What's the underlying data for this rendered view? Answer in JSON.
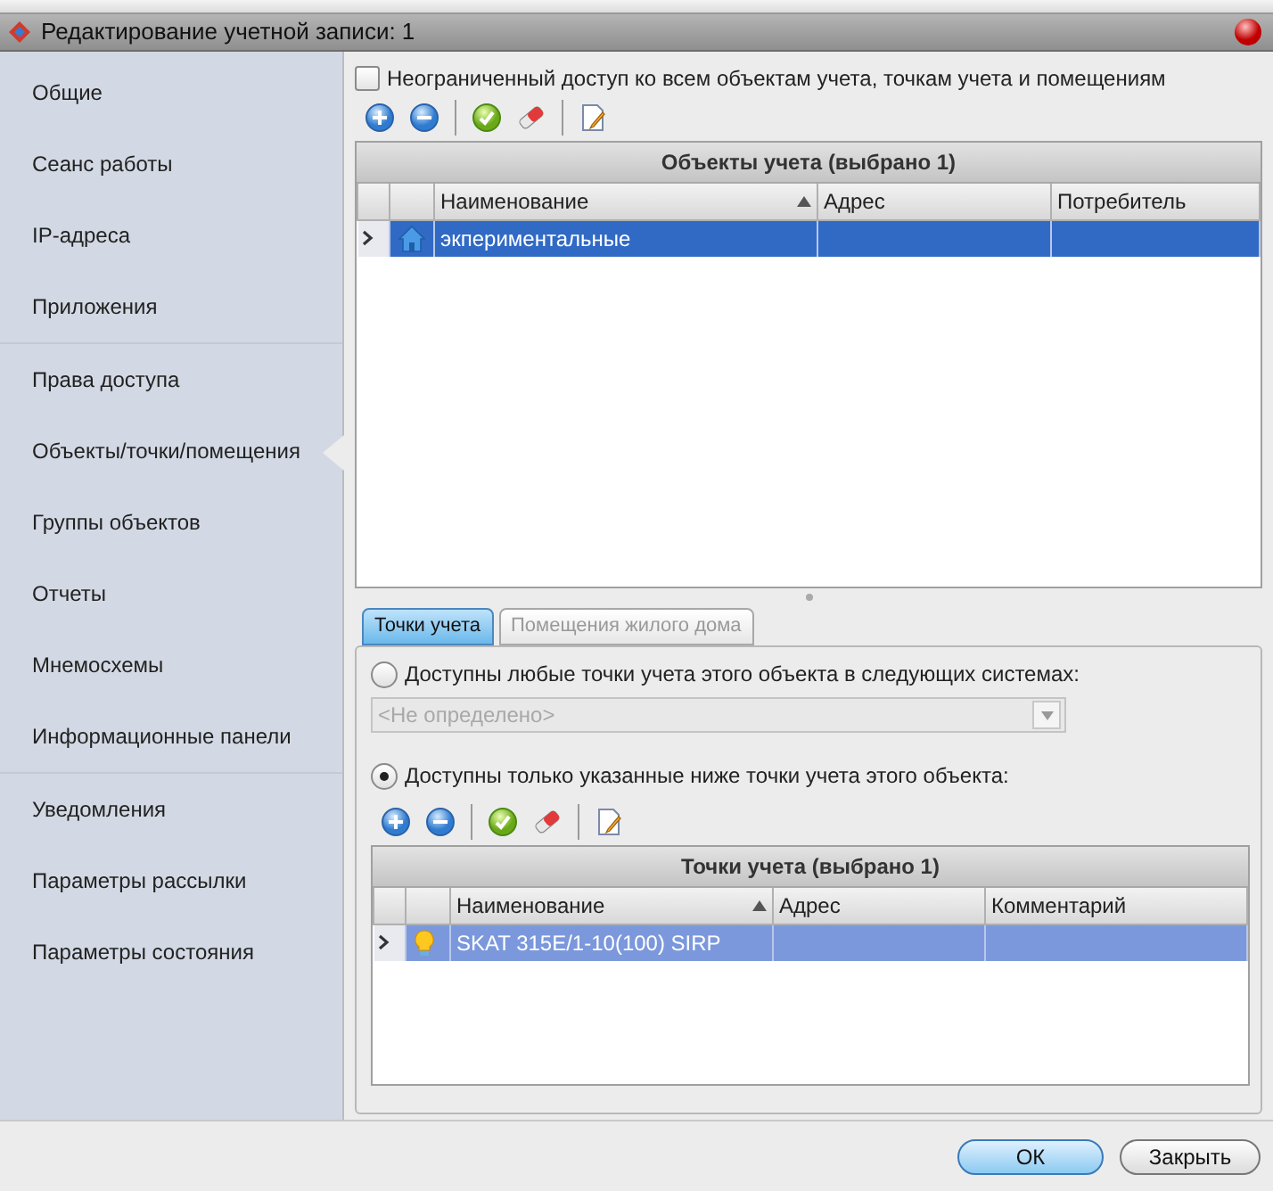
{
  "window": {
    "title": "Редактирование учетной записи: 1"
  },
  "sidebar": {
    "groups": [
      [
        {
          "label": "Общие",
          "selected": false
        },
        {
          "label": "Сеанс работы",
          "selected": false
        },
        {
          "label": "IP-адреса",
          "selected": false
        },
        {
          "label": "Приложения",
          "selected": false
        }
      ],
      [
        {
          "label": "Права доступа",
          "selected": false
        },
        {
          "label": "Объекты/точки/помещения",
          "selected": true
        },
        {
          "label": "Группы объектов",
          "selected": false
        },
        {
          "label": "Отчеты",
          "selected": false
        },
        {
          "label": "Мнемосхемы",
          "selected": false
        },
        {
          "label": "Информационные панели",
          "selected": false
        }
      ],
      [
        {
          "label": "Уведомления",
          "selected": false
        },
        {
          "label": "Параметры рассылки",
          "selected": false
        },
        {
          "label": "Параметры состояния",
          "selected": false
        }
      ]
    ]
  },
  "objects": {
    "unlimited_access": {
      "label": "Неограниченный доступ ко всем объектам учета, точкам учета и помещениям",
      "checked": false
    },
    "grid": {
      "title": "Объекты учета (выбрано 1)",
      "focused": true,
      "columns": [
        {
          "label": "Наименование",
          "sorted": true
        },
        {
          "label": "Адрес",
          "sorted": false
        },
        {
          "label": "Потребитель",
          "sorted": false
        }
      ],
      "rows": [
        {
          "kind": "object",
          "selected": true,
          "cells": [
            "экпериментальные",
            "",
            ""
          ]
        }
      ]
    }
  },
  "tabs": [
    {
      "label": "Точки учета",
      "selected": true
    },
    {
      "label": "Помещения жилого дома",
      "selected": false
    }
  ],
  "points": {
    "options": [
      {
        "label": "Доступны любые точки учета этого объекта в следующих системах:",
        "selected": false
      },
      {
        "label": "Доступны только указанные ниже точки учета этого объекта:",
        "selected": true
      }
    ],
    "systems_combo": {
      "value": "<Не определено>",
      "disabled": true
    },
    "grid": {
      "title": "Точки учета (выбрано 1)",
      "focused": false,
      "columns": [
        {
          "label": "Наименование",
          "sorted": true
        },
        {
          "label": "Адрес",
          "sorted": false
        },
        {
          "label": "Комментарий",
          "sorted": false
        }
      ],
      "rows": [
        {
          "kind": "meter",
          "selected": true,
          "cells": [
            "SKAT 315E/1-10(100) SIRP",
            "",
            ""
          ]
        }
      ]
    }
  },
  "buttons": [
    {
      "label": "ОК",
      "default": true
    },
    {
      "label": "Закрыть",
      "default": false
    }
  ]
}
